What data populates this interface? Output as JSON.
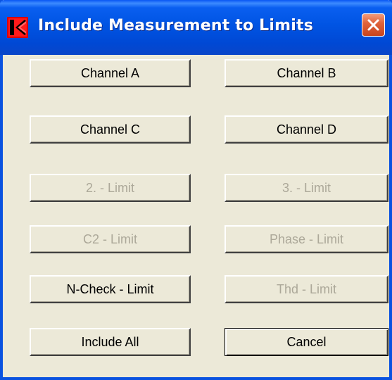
{
  "window": {
    "title": "Include Measurement to Limits",
    "icon": "app-logo-icon",
    "close_icon": "close-icon"
  },
  "buttons": {
    "channel_a": "Channel A",
    "channel_b": "Channel B",
    "channel_c": "Channel C",
    "channel_d": "Channel D",
    "limit_2": "2. - Limit",
    "limit_3": "3. - Limit",
    "c2_limit": "C2 - Limit",
    "phase_limit": "Phase - Limit",
    "ncheck_limit": "N-Check - Limit",
    "thd_limit": "Thd - Limit",
    "include_all": "Include All",
    "cancel": "Cancel"
  },
  "colors": {
    "titlebar": "#0054e3",
    "face": "#ece9d8",
    "disabled_text": "#aca899",
    "close": "#e0643c"
  }
}
